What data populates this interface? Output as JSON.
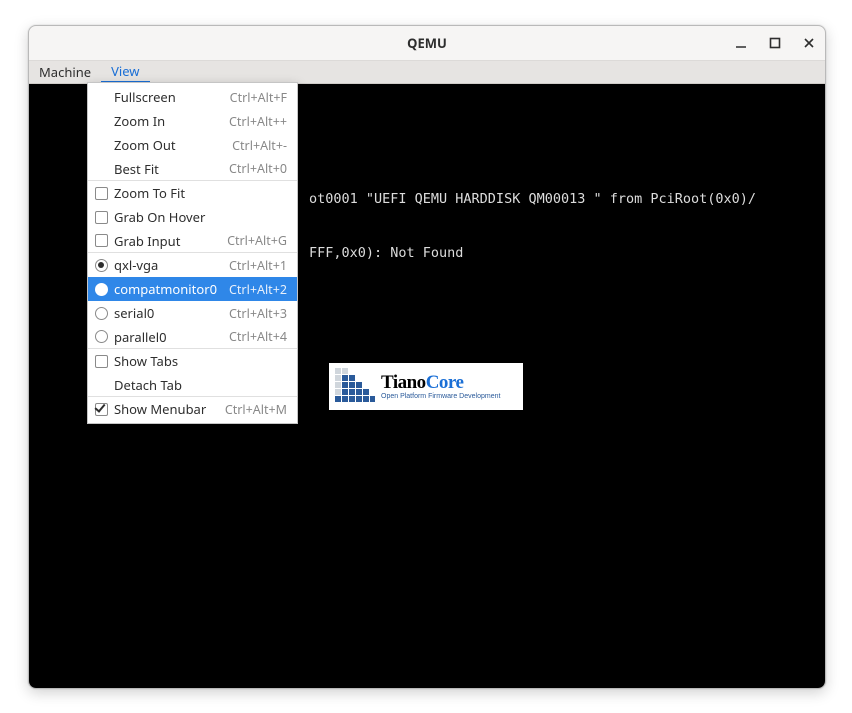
{
  "window": {
    "title": "QEMU"
  },
  "menubar": {
    "machine": "Machine",
    "view": "View"
  },
  "view_menu": {
    "fullscreen": {
      "label": "Fullscreen",
      "accel": "Ctrl+Alt+F"
    },
    "zoom_in": {
      "label": "Zoom In",
      "accel": "Ctrl+Alt++"
    },
    "zoom_out": {
      "label": "Zoom Out",
      "accel": "Ctrl+Alt+-"
    },
    "best_fit": {
      "label": "Best Fit",
      "accel": "Ctrl+Alt+0"
    },
    "zoom_to_fit": {
      "label": "Zoom To Fit"
    },
    "grab_hover": {
      "label": "Grab On Hover"
    },
    "grab_input": {
      "label": "Grab Input",
      "accel": "Ctrl+Alt+G"
    },
    "qxl_vga": {
      "label": "qxl-vga",
      "accel": "Ctrl+Alt+1"
    },
    "compat": {
      "label": "compatmonitor0",
      "accel": "Ctrl+Alt+2"
    },
    "serial0": {
      "label": "serial0",
      "accel": "Ctrl+Alt+3"
    },
    "parallel0": {
      "label": "parallel0",
      "accel": "Ctrl+Alt+4"
    },
    "show_tabs": {
      "label": "Show Tabs"
    },
    "detach_tab": {
      "label": "Detach Tab"
    },
    "show_menubar": {
      "label": "Show Menubar",
      "accel": "Ctrl+Alt+M"
    }
  },
  "terminal": {
    "line1": "ot0001 \"UEFI QEMU HARDDISK QM00013 \" from PciRoot(0x0)/",
    "line2": "FFF,0x0): Not Found"
  },
  "logo": {
    "brand_a": "Tiano",
    "brand_b": "Core",
    "sub": "Open Platform Firmware Development"
  }
}
